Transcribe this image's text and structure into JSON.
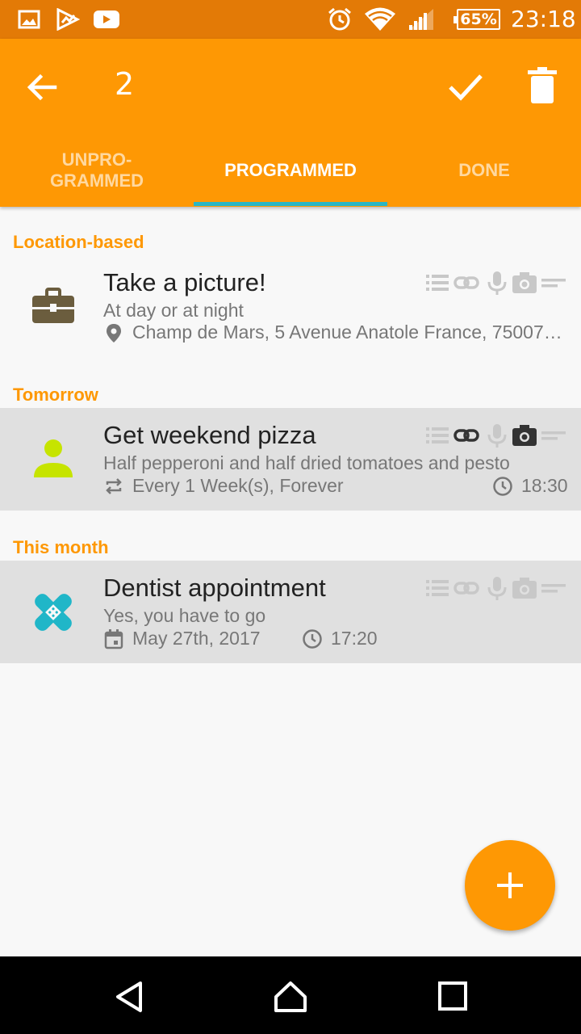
{
  "status_bar": {
    "icons": [
      "image-icon",
      "play-store-icon",
      "youtube-icon",
      "alarm-icon",
      "wifi-icon",
      "cell-signal-icon"
    ],
    "battery": "65%",
    "time": "23:18"
  },
  "app_bar": {
    "back_icon": "arrow-back-icon",
    "selected_count": "2",
    "confirm_icon": "check-icon",
    "delete_icon": "trash-icon",
    "tabs": [
      {
        "label": "UNPRO-\nGRAMMED",
        "active": false
      },
      {
        "label": "PROGRAMMED",
        "active": true
      },
      {
        "label": "DONE",
        "active": false
      }
    ],
    "indicator_color": "#29b6c4"
  },
  "colors": {
    "status_bar": "#e37a06",
    "primary": "#fe9804",
    "selected_row": "#e0e0e0",
    "section_header": "#fe9804"
  },
  "sections": [
    {
      "header": "Location-based",
      "items": [
        {
          "icon": "briefcase-icon",
          "title": "Take a picture!",
          "subtitle": "At day or at night",
          "meta_icon": "location-pin-icon",
          "meta_text": "Champ de Mars, 5 Avenue Anatole France, 75007…",
          "selected": false
        }
      ]
    },
    {
      "header": "Tomorrow",
      "items": [
        {
          "icon": "person-icon",
          "title": "Get weekend pizza",
          "subtitle": "Half pepperoni and half dried tomatoes and pesto",
          "meta_icon": "repeat-icon",
          "meta_text": "Every 1 Week(s), Forever",
          "time_icon": "clock-icon",
          "time": "18:30",
          "selected": true
        }
      ]
    },
    {
      "header": "This month",
      "items": [
        {
          "icon": "bandage-icon",
          "title": "Dentist appointment",
          "subtitle": "Yes, you have to go",
          "meta_icon": "calendar-icon",
          "meta_text": "May 27th, 2017",
          "time_icon": "clock-icon",
          "time": "17:20",
          "selected": true
        }
      ]
    }
  ],
  "attachment_icons": [
    "checklist-icon",
    "link-icon",
    "microphone-icon",
    "camera-icon",
    "notes-icon"
  ],
  "fab": {
    "icon": "plus-icon"
  },
  "nav_bar": {
    "icons": [
      "back-triangle-icon",
      "home-icon",
      "recents-icon"
    ]
  }
}
